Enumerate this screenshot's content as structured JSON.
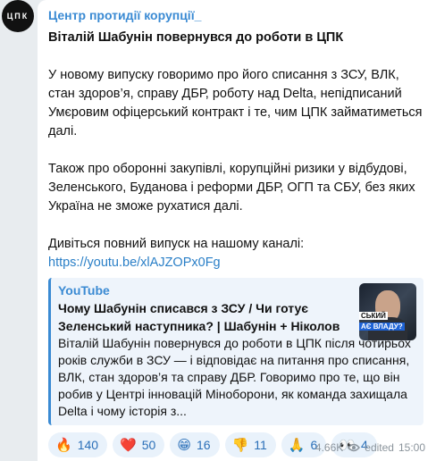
{
  "avatar": {
    "text": "ЦПК"
  },
  "channel": {
    "name": "Центр протидії корупції_"
  },
  "post": {
    "title": "Віталій Шабунін повернувся до роботи в ЦПК",
    "paragraph1": "У новому випуску говоримо про його списання з ЗСУ, ВЛК, стан здоров’я, справу ДБР, роботу над Delta, непідписаний Умєровим офіцерський контракт і те, чим ЦПК займатиметься далі.",
    "paragraph2": "Також про оборонні закупівлі, корупційні ризики у відбудові, Зеленського, Буданова і реформи ДБР, ОГП та СБУ, без яких Україна не зможе рухатися далі.",
    "paragraph3": "Дивіться повний випуск на нашому каналі:",
    "link": "https://youtu.be/xlAJZOPx0Fg"
  },
  "preview": {
    "site": "YouTube",
    "title": "Чому Шабунін списався з ЗСУ / Чи готує Зеленський наступника? | Шабунін + Ніколов",
    "description": "Віталій Шабунін повернувся до роботи в ЦПК після чотирьох років служби в ЗСУ — і відповідає на питання про списання, ВЛК, стан здоров’я та справу ДБР. Говоримо про те, що він робив у Центрі інновацій Міноборони, як команда захищала Delta і чому історія з...",
    "thumb_text1": "СЬКИЙ",
    "thumb_text2": "АЄ ВЛАДУ?"
  },
  "reactions": [
    {
      "emoji": "🔥",
      "count": "140"
    },
    {
      "emoji": "❤️",
      "count": "50"
    },
    {
      "emoji": "😁",
      "count": "16"
    },
    {
      "emoji": "👎",
      "count": "11"
    },
    {
      "emoji": "🙏",
      "count": "6"
    },
    {
      "emoji": "👀",
      "count": "4"
    }
  ],
  "meta": {
    "views": "4.66K",
    "edited": "edited",
    "time": "15:00"
  }
}
